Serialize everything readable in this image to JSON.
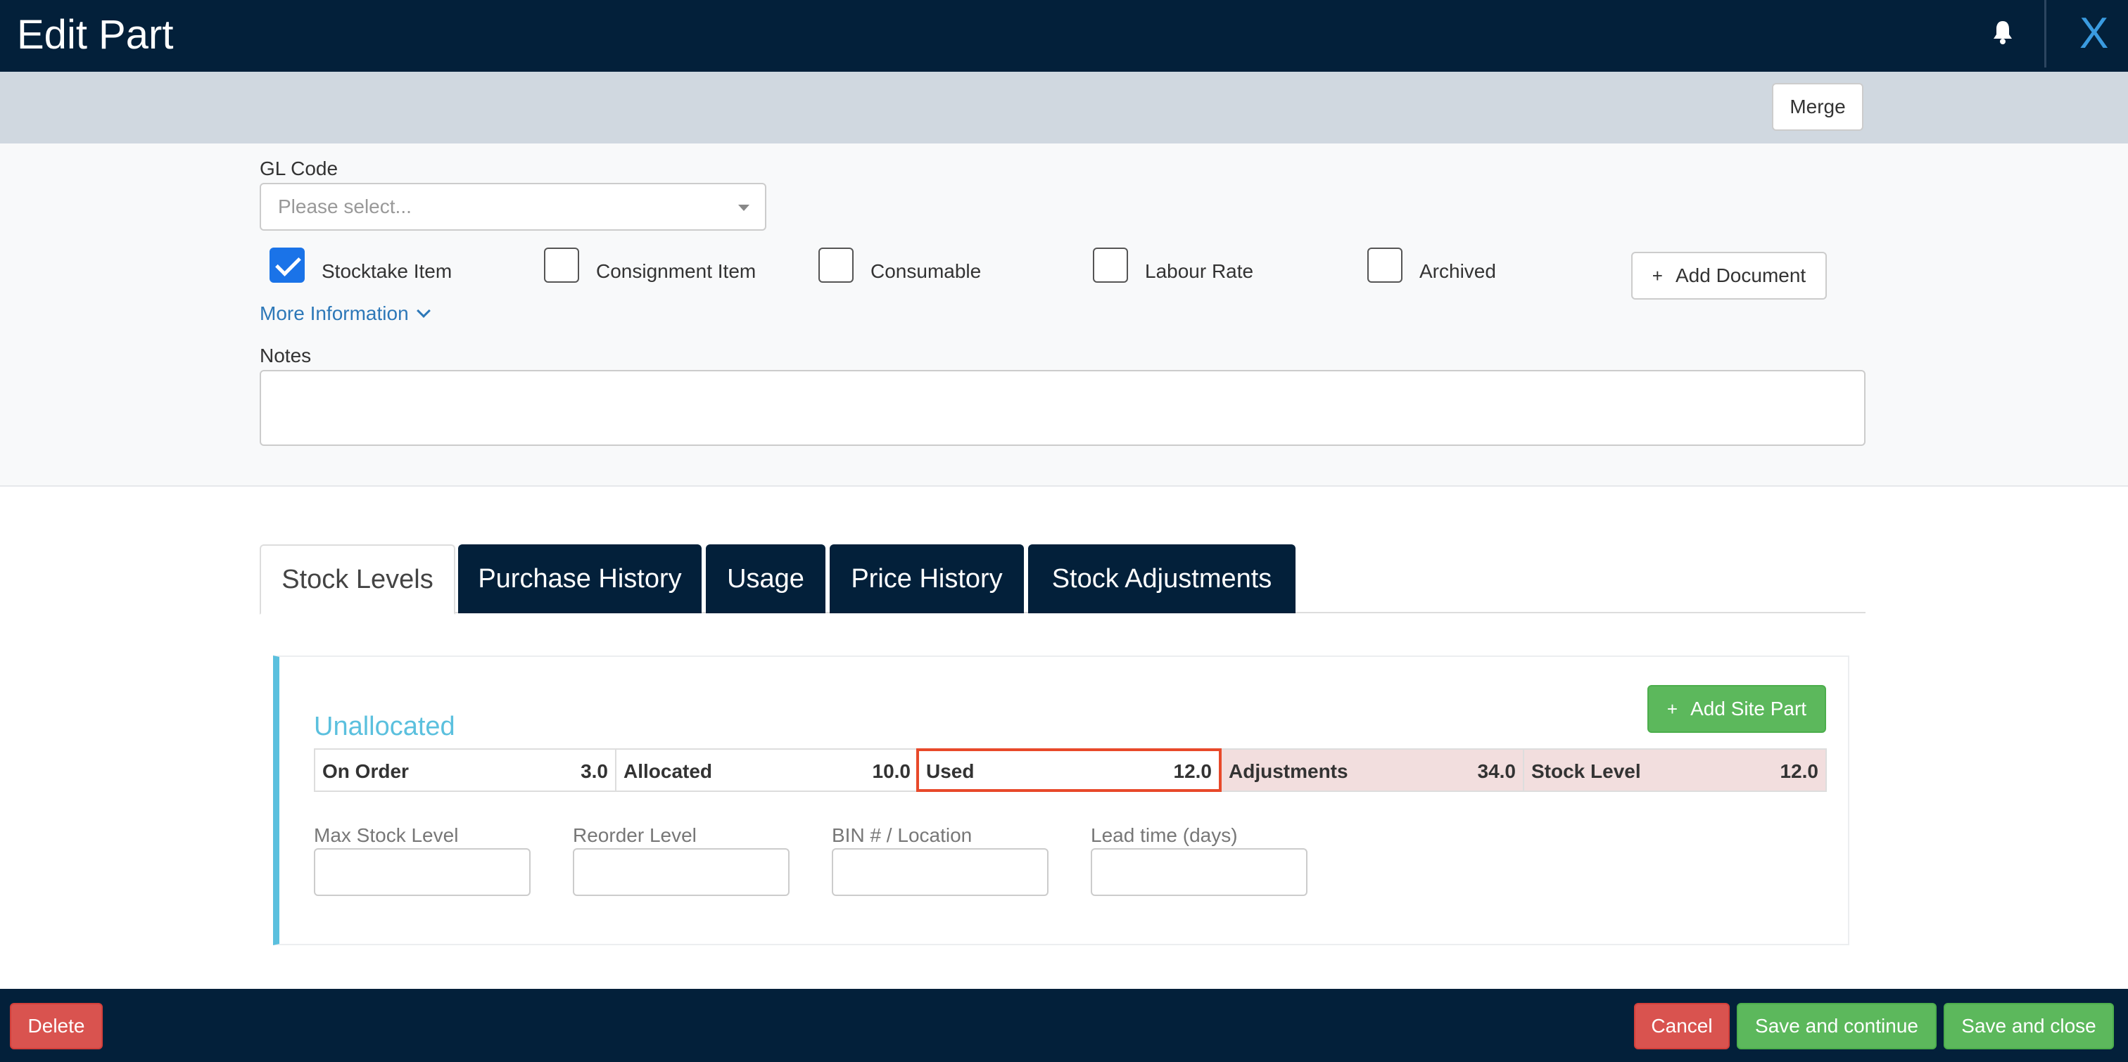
{
  "header": {
    "title": "Edit Part",
    "bell_icon": "bell-icon",
    "close_label": "X"
  },
  "toolbar": {
    "merge_label": "Merge"
  },
  "form": {
    "gl_code_label": "GL Code",
    "gl_code_placeholder": "Please select...",
    "checkboxes": [
      {
        "label": "Stocktake Item",
        "checked": true
      },
      {
        "label": "Consignment Item",
        "checked": false
      },
      {
        "label": "Consumable",
        "checked": false
      },
      {
        "label": "Labour Rate",
        "checked": false
      },
      {
        "label": "Archived",
        "checked": false
      }
    ],
    "add_document_label": "Add Document",
    "more_information_label": "More Information",
    "notes_label": "Notes",
    "notes_value": ""
  },
  "tabs": [
    {
      "label": "Stock Levels",
      "active": true
    },
    {
      "label": "Purchase History",
      "active": false
    },
    {
      "label": "Usage",
      "active": false
    },
    {
      "label": "Price History",
      "active": false
    },
    {
      "label": "Stock Adjustments",
      "active": false
    }
  ],
  "stock": {
    "section_title": "Unallocated",
    "add_site_part_label": "Add Site Part",
    "stats": [
      {
        "label": "On Order",
        "value": "3.0"
      },
      {
        "label": "Allocated",
        "value": "10.0"
      },
      {
        "label": "Used",
        "value": "12.0"
      },
      {
        "label": "Adjustments",
        "value": "34.0"
      },
      {
        "label": "Stock Level",
        "value": "12.0"
      }
    ],
    "fields": [
      {
        "label": "Max Stock Level",
        "value": ""
      },
      {
        "label": "Reorder Level",
        "value": ""
      },
      {
        "label": "BIN # / Location",
        "value": ""
      },
      {
        "label": "Lead time (days)",
        "value": ""
      }
    ]
  },
  "footer": {
    "delete_label": "Delete",
    "cancel_label": "Cancel",
    "save_continue_label": "Save and continue",
    "save_close_label": "Save and close"
  },
  "colors": {
    "header_bg": "#03203a",
    "accent_blue": "#5bc0de",
    "success_green": "#5cb85c",
    "danger_red": "#d9534f",
    "highlight_red": "#e8492a"
  }
}
